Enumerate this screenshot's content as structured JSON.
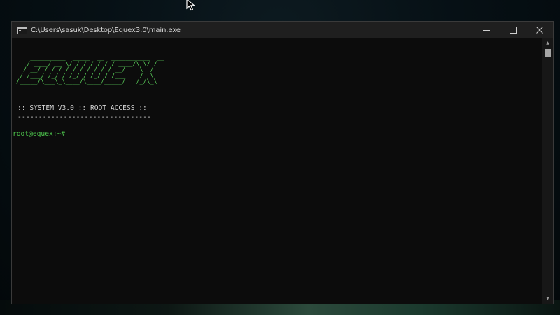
{
  "window": {
    "title": "C:\\Users\\sasuk\\Desktop\\Equex3.0\\main.exe",
    "minimize_glyph": "—",
    "maximize_glyph": "☐",
    "close_glyph": "✕"
  },
  "console": {
    "banner_lines": [
      "     __________  _____  __  ___________  __",
      "    / ____/ __ \\/ / / / / / / ____/\\ \\/ /",
      "   / __/ / / / / / / / / / / __/    \\  / ",
      "  / /___/ /_/ / /_/ / /_/ / /___    /  \\ ",
      " /_____/\\___\\_\\____/\\____/_____/   /_/\\_\\"
    ],
    "system_line": ":: SYSTEM V3.0 :: ROOT ACCESS ::",
    "separator": "--------------------------------",
    "prompt": "root@equex:~#"
  },
  "colors": {
    "banner": "#5bd15b",
    "prompt": "#4ec94e",
    "text": "#d4d4d4",
    "background": "#0c0c0c"
  }
}
